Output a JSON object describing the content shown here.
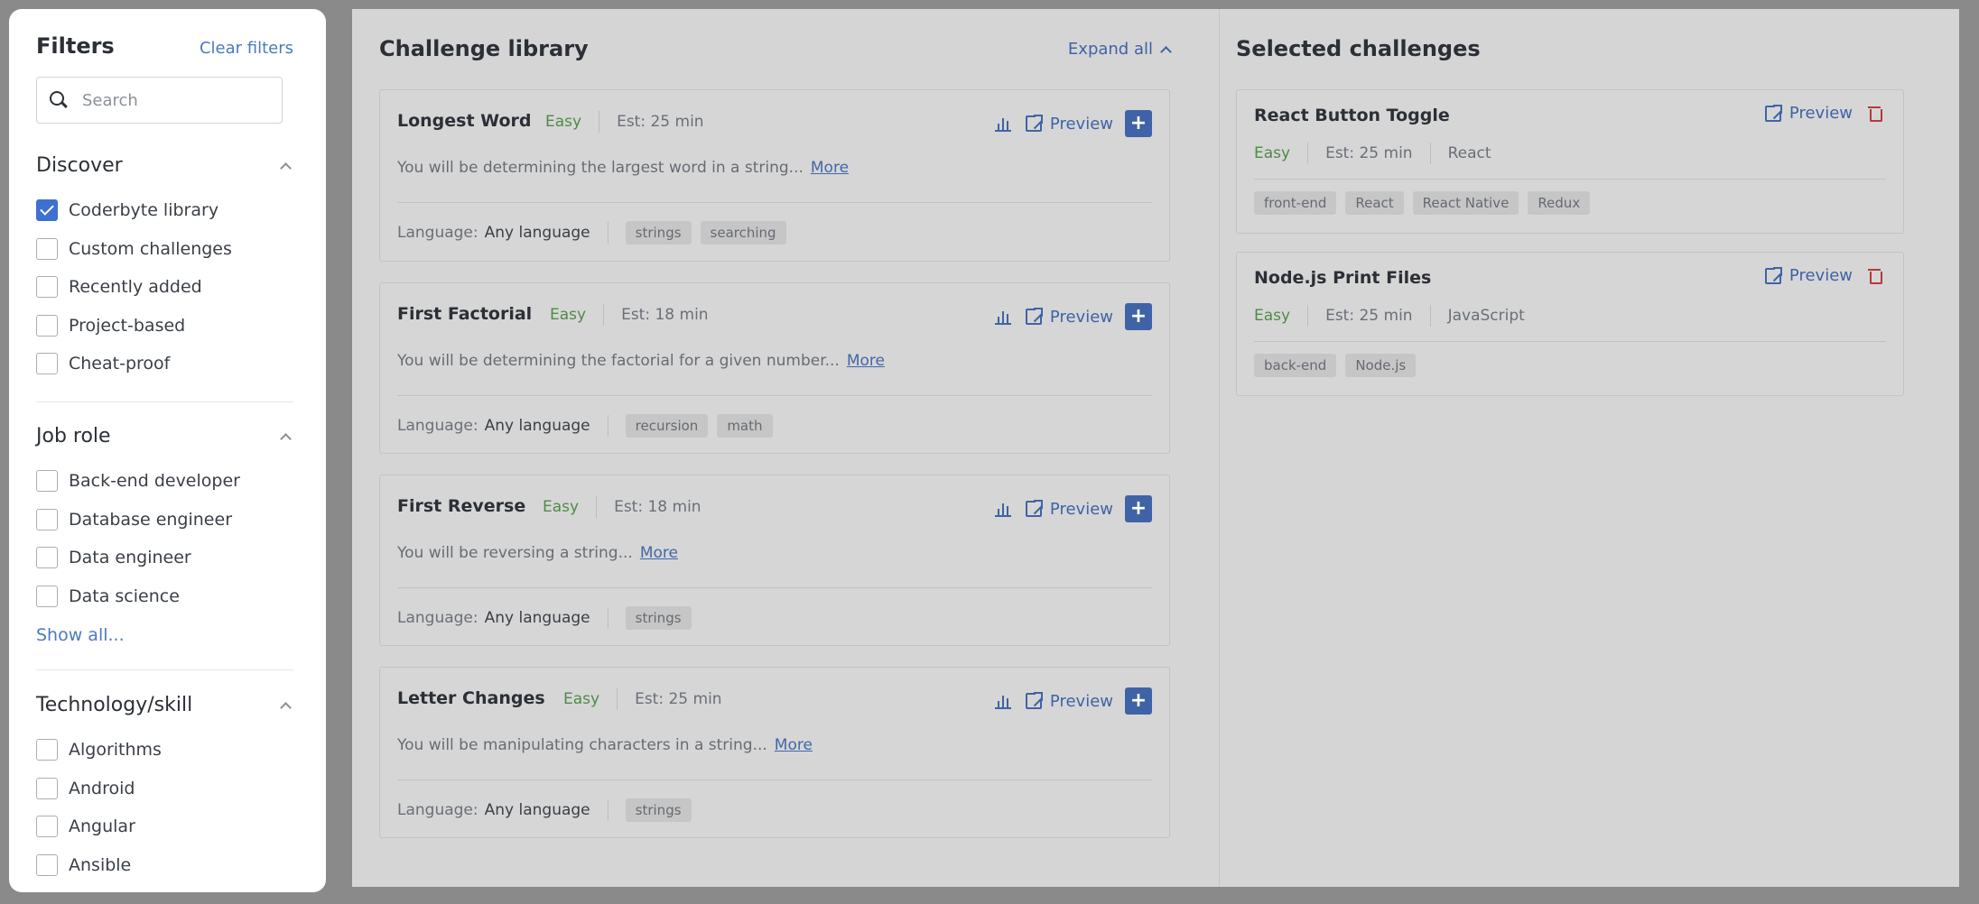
{
  "sidebar": {
    "title": "Filters",
    "clear_label": "Clear filters",
    "search_placeholder": "Search",
    "discover": {
      "title": "Discover",
      "items": [
        {
          "label": "Coderbyte library",
          "checked": true
        },
        {
          "label": "Custom challenges",
          "checked": false
        },
        {
          "label": "Recently added",
          "checked": false
        },
        {
          "label": "Project-based",
          "checked": false
        },
        {
          "label": "Cheat-proof",
          "checked": false
        }
      ]
    },
    "job_role": {
      "title": "Job role",
      "items": [
        {
          "label": "Back-end developer",
          "checked": false
        },
        {
          "label": "Database engineer",
          "checked": false
        },
        {
          "label": "Data engineer",
          "checked": false
        },
        {
          "label": "Data science",
          "checked": false
        }
      ],
      "show_all": "Show all..."
    },
    "tech": {
      "title": "Technology/skill",
      "items": [
        {
          "label": "Algorithms",
          "checked": false
        },
        {
          "label": "Android",
          "checked": false
        },
        {
          "label": "Angular",
          "checked": false
        },
        {
          "label": "Ansible",
          "checked": false
        }
      ]
    }
  },
  "library": {
    "title": "Challenge library",
    "expand_label": "Expand all",
    "preview_label": "Preview",
    "language_label": "Language:",
    "more_label": "More",
    "cards": [
      {
        "title": "Longest Word",
        "difficulty": "Easy",
        "est": "Est: 25 min",
        "desc": "You will be determining the largest word in a string...",
        "language": "Any language",
        "tags": [
          "strings",
          "searching"
        ]
      },
      {
        "title": "First Factorial",
        "difficulty": "Easy",
        "est": "Est: 18 min",
        "desc": "You will be determining the factorial for a given number...",
        "language": "Any language",
        "tags": [
          "recursion",
          "math"
        ]
      },
      {
        "title": "First Reverse",
        "difficulty": "Easy",
        "est": "Est: 18 min",
        "desc": "You will be reversing a string...",
        "language": "Any language",
        "tags": [
          "strings"
        ]
      },
      {
        "title": "Letter Changes",
        "difficulty": "Easy",
        "est": "Est: 25 min",
        "desc": "You will be manipulating characters in a string...",
        "language": "Any language",
        "tags": [
          "strings"
        ]
      }
    ]
  },
  "selected": {
    "title": "Selected challenges",
    "preview_label": "Preview",
    "cards": [
      {
        "title": "React Button Toggle",
        "difficulty": "Easy",
        "est": "Est: 25 min",
        "language": "React",
        "tags": [
          "front-end",
          "React",
          "React Native",
          "Redux"
        ]
      },
      {
        "title": "Node.js Print Files",
        "difficulty": "Easy",
        "est": "Est: 25 min",
        "language": "JavaScript",
        "tags": [
          "back-end",
          "Node.js"
        ]
      }
    ]
  },
  "colors": {
    "accent": "#3f63a6",
    "easy": "#4f8b46",
    "checkbox": "#3f6fd0",
    "danger": "#b53a3a"
  },
  "icons": {
    "search": "search-icon",
    "stats": "bar-chart-icon",
    "preview": "external-link-icon",
    "add": "plus-icon",
    "delete": "trash-icon",
    "collapse": "chevron-up-icon"
  }
}
